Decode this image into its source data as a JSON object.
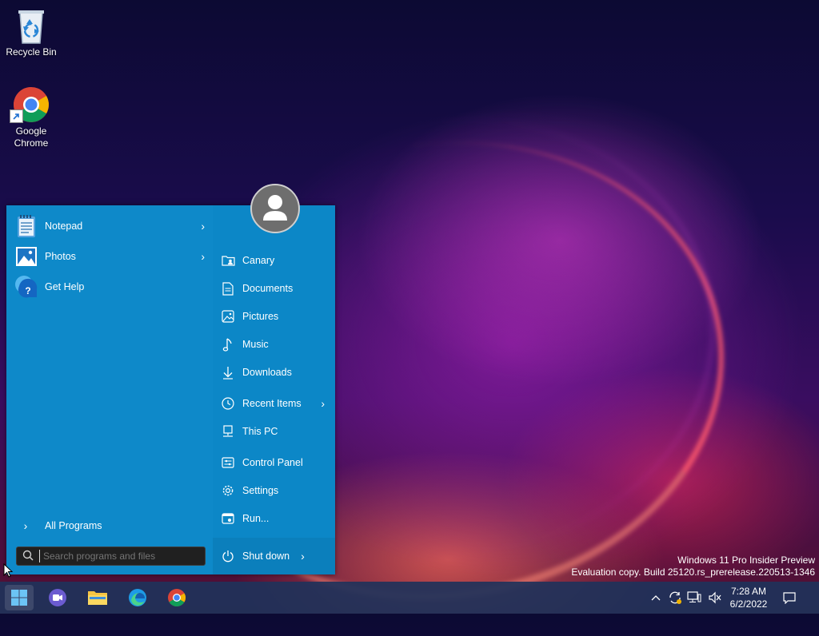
{
  "desktop": {
    "icons": [
      {
        "label": "Recycle Bin",
        "icon": "recycle-bin-icon"
      },
      {
        "label": "Google Chrome",
        "icon": "chrome-icon"
      }
    ]
  },
  "start_menu": {
    "programs": [
      {
        "label": "Notepad",
        "icon": "notepad-icon",
        "has_submenu": true
      },
      {
        "label": "Photos",
        "icon": "photos-icon",
        "has_submenu": true
      },
      {
        "label": "Get Help",
        "icon": "get-help-icon",
        "has_submenu": false
      }
    ],
    "all_programs_label": "All Programs",
    "search_placeholder": "Search programs and files",
    "right_items": [
      {
        "label": "Canary",
        "icon": "user-folder-icon"
      },
      {
        "label": "Documents",
        "icon": "document-icon"
      },
      {
        "label": "Pictures",
        "icon": "picture-icon"
      },
      {
        "label": "Music",
        "icon": "music-note-icon"
      },
      {
        "label": "Downloads",
        "icon": "download-arrow-icon"
      },
      {
        "label": "Recent Items",
        "icon": "clock-icon",
        "has_submenu": true
      },
      {
        "label": "This PC",
        "icon": "computer-icon"
      },
      {
        "label": "Control Panel",
        "icon": "control-panel-icon"
      },
      {
        "label": "Settings",
        "icon": "gear-icon"
      },
      {
        "label": "Run...",
        "icon": "run-icon"
      }
    ],
    "shutdown_label": "Shut down"
  },
  "watermark": {
    "line1": "Windows 11 Pro Insider Preview",
    "line2": "Evaluation copy. Build 25120.rs_prerelease.220513-1346"
  },
  "taskbar": {
    "apps": [
      "start-icon",
      "teams-chat-icon",
      "file-explorer-icon",
      "edge-icon",
      "chrome-icon"
    ],
    "clock_time": "7:28 AM",
    "clock_date": "6/2/2022"
  },
  "colors": {
    "start_menu_bg": "#0c87c7",
    "taskbar_bg": "#20325a",
    "search_bg": "#202020"
  }
}
